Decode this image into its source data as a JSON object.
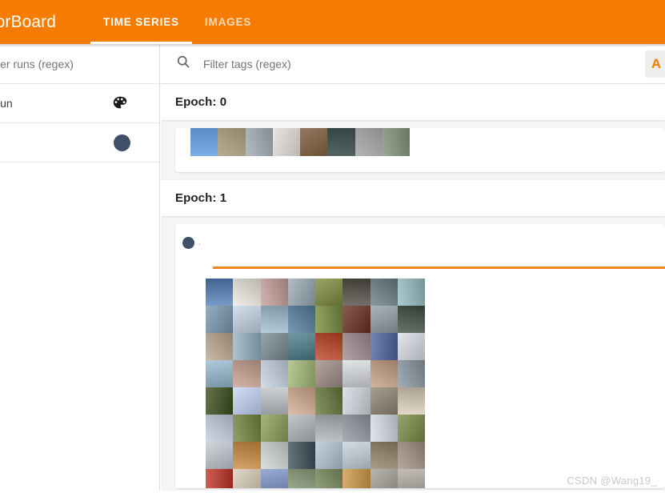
{
  "appbar": {
    "brand": "sorBoard",
    "tabs": [
      {
        "label": "TIME SERIES",
        "active": true
      },
      {
        "label": "IMAGES",
        "active": false
      }
    ],
    "background_color": "#f57c00"
  },
  "sidebar": {
    "runs_filter_placeholder": "ilter runs (regex)",
    "run_section_label": "Run",
    "palette_icon": "palette-icon",
    "run_swatch_color": "#3f5069"
  },
  "main": {
    "tag_filter_placeholder": "Filter tags (regex)",
    "search_icon": "search-icon",
    "corner_button_glyph": "A",
    "corner_button_color": "#f57c00",
    "sections": [
      {
        "header": "Epoch: 0",
        "card": {
          "swatch_color": "#3f5069",
          "title": "."
        }
      },
      {
        "header": "Epoch: 1",
        "card": {
          "swatch_color": "#3f5069",
          "title": "."
        }
      }
    ],
    "slider_color": "#f4831f"
  },
  "watermark": "CSDN @Wang19_",
  "image_grid": {
    "columns": 8,
    "rows": 8,
    "strip_colors": [
      "#5f93c9",
      "#9d9478",
      "#9aa1ab",
      "#d8d4cf",
      "#8a6f55",
      "#3d4a4a",
      "#9a9a9a",
      "#7e8e77"
    ],
    "grid_colors": [
      "#5e80ad",
      "#d6d4cc",
      "#b79a95",
      "#97a3ab",
      "#7e8b4b",
      "#5c5852",
      "#6e7f86",
      "#92b2b6",
      "#7c94a8",
      "#b9c6d2",
      "#9ab4c0",
      "#5d7f9a",
      "#7d8b4f",
      "#6e4336",
      "#8f9aa3",
      "#4e5a52",
      "#b0a08c",
      "#93a9b8",
      "#7c8b92",
      "#587f89",
      "#b05139",
      "#9d8a8e",
      "#5b6b9c",
      "#c9ccd2",
      "#95b0c2",
      "#b99c8e",
      "#b9c3cd",
      "#9fb07c",
      "#9a8d87",
      "#c8cbce",
      "#b99a84",
      "#8a949d",
      "#4c5a33",
      "#b9c5e0",
      "#b4b8bb",
      "#c3a58f",
      "#6d7b4b",
      "#c2c9cf",
      "#8e8576",
      "#c9bfae",
      "#b5bfcd",
      "#77864a",
      "#8c9a63",
      "#a8aeb0",
      "#a9acae",
      "#8f949a",
      "#c6ccd2",
      "#7d8a53",
      "#b6bcc1",
      "#bc8a51",
      "#c0c6c2",
      "#4e5b63",
      "#a9b8c4",
      "#b8c3cc",
      "#8e8470",
      "#9c8f86",
      "#b3453a",
      "#c8bfae",
      "#7f92bc",
      "#8b9a7e",
      "#7f8d66",
      "#c09452",
      "#9f9c96",
      "#a9a49d"
    ]
  }
}
